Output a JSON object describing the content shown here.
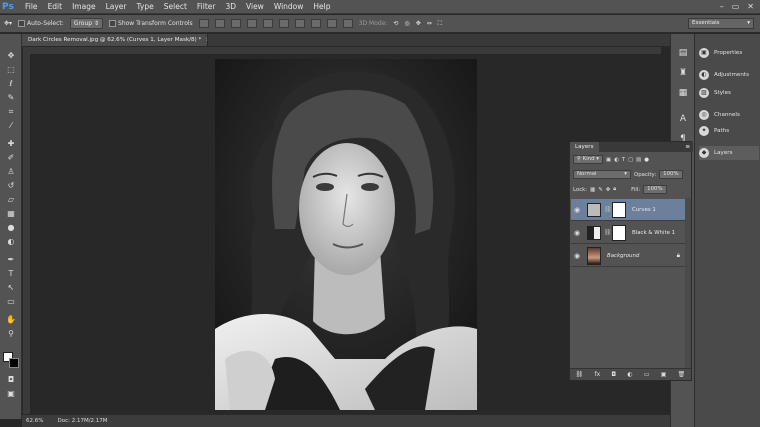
{
  "app": {
    "logo": "Ps"
  },
  "menubar": {
    "items": [
      "File",
      "Edit",
      "Image",
      "Layer",
      "Type",
      "Select",
      "Filter",
      "3D",
      "View",
      "Window",
      "Help"
    ],
    "window_controls": [
      "–",
      "▭",
      "✕"
    ]
  },
  "options_bar": {
    "auto_select_label": "Auto-Select:",
    "auto_select_value": "Group",
    "show_transform_label": "Show Transform Controls",
    "mode_label": "3D Mode:",
    "workspace": "Essentials"
  },
  "document": {
    "tab_title": "Dark Circles Removal.jpg @ 62.6% (Curves 1, Layer Mask/8) *",
    "tab_close": "×"
  },
  "status": {
    "zoom": "62.6%",
    "doc_size": "Doc: 2.17M/2.17M"
  },
  "dock_panels": [
    {
      "label": "Properties",
      "icon": "properties-icon"
    },
    {
      "label": "Adjustments",
      "icon": "adjustments-icon"
    },
    {
      "label": "Styles",
      "icon": "styles-icon"
    },
    {
      "label": "Channels",
      "icon": "channels-icon"
    },
    {
      "label": "Paths",
      "icon": "paths-icon"
    },
    {
      "label": "Layers",
      "icon": "layers-icon"
    }
  ],
  "layers_panel": {
    "title": "Layers",
    "filter_kind": "Kind",
    "blend_mode": "Normal",
    "opacity_label": "Opacity:",
    "opacity_value": "100%",
    "lock_label": "Lock:",
    "fill_label": "Fill:",
    "fill_value": "100%",
    "layers": [
      {
        "name": "Curves 1",
        "selected": true,
        "type": "adjustment"
      },
      {
        "name": "Black & White 1",
        "selected": false,
        "type": "adjustment"
      },
      {
        "name": "Background",
        "selected": false,
        "type": "image",
        "locked": true
      }
    ],
    "footer_icons": [
      "link-icon",
      "fx-icon",
      "mask-icon",
      "adjustment-icon",
      "group-icon",
      "new-layer-icon",
      "trash-icon"
    ]
  },
  "colors": {
    "accent_selected": "#6c7f9b",
    "ps_blue": "#3ea3ff"
  }
}
